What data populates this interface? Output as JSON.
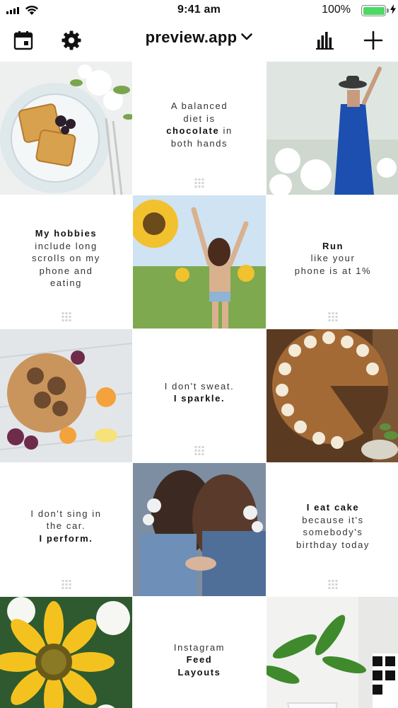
{
  "status_bar": {
    "time": "9:41 am",
    "battery_percent": "100%",
    "battery_level": 1.0,
    "battery_color": "#4cd964"
  },
  "nav": {
    "title": "preview.app",
    "left_icons": [
      "calendar-icon",
      "gear-icon"
    ],
    "right_icons": [
      "bar-chart-icon",
      "plus-icon"
    ]
  },
  "grid": {
    "tiles": [
      {
        "type": "photo",
        "subject": "waffles with berries and flowers on a plate"
      },
      {
        "type": "text",
        "lines": [
          {
            "parts": [
              {
                "text": "A balanced",
                "bold": false
              }
            ]
          },
          {
            "parts": [
              {
                "text": "diet is",
                "bold": false
              }
            ]
          },
          {
            "parts": [
              {
                "text": "chocolate",
                "bold": true
              },
              {
                "text": " in",
                "bold": false
              }
            ]
          },
          {
            "parts": [
              {
                "text": "both hands",
                "bold": false
              }
            ]
          }
        ]
      },
      {
        "type": "photo",
        "subject": "woman in hat and blue dress in a flower field"
      },
      {
        "type": "text",
        "lines": [
          {
            "parts": [
              {
                "text": "My hobbies",
                "bold": true
              }
            ]
          },
          {
            "parts": [
              {
                "text": "include long",
                "bold": false
              }
            ]
          },
          {
            "parts": [
              {
                "text": "scrolls on my",
                "bold": false
              }
            ]
          },
          {
            "parts": [
              {
                "text": "phone and",
                "bold": false
              }
            ]
          },
          {
            "parts": [
              {
                "text": "eating",
                "bold": false
              }
            ]
          }
        ]
      },
      {
        "type": "photo",
        "subject": "woman with raised arms in a sunflower field"
      },
      {
        "type": "text",
        "lines": [
          {
            "parts": [
              {
                "text": "Run",
                "bold": true
              }
            ]
          },
          {
            "parts": [
              {
                "text": "like your",
                "bold": false
              }
            ]
          },
          {
            "parts": [
              {
                "text": "phone is at 1%",
                "bold": false
              }
            ]
          }
        ]
      },
      {
        "type": "photo",
        "subject": "energy balls, passion fruit and oranges on white wood"
      },
      {
        "type": "text",
        "lines": [
          {
            "parts": [
              {
                "text": "I don't sweat.",
                "bold": false
              }
            ]
          },
          {
            "parts": [
              {
                "text": "I sparkle.",
                "bold": true
              }
            ]
          }
        ]
      },
      {
        "type": "photo",
        "subject": "banana nut cake with a slice missing"
      },
      {
        "type": "text",
        "lines": [
          {
            "parts": [
              {
                "text": "I don't sing in",
                "bold": false
              }
            ]
          },
          {
            "parts": [
              {
                "text": "the car.",
                "bold": false
              }
            ]
          },
          {
            "parts": [
              {
                "text": "I perform.",
                "bold": true
              }
            ]
          }
        ]
      },
      {
        "type": "photo",
        "subject": "two friends in denim jackets hugging"
      },
      {
        "type": "text",
        "lines": [
          {
            "parts": [
              {
                "text": "I eat cake",
                "bold": true
              }
            ]
          },
          {
            "parts": [
              {
                "text": "because it's",
                "bold": false
              }
            ]
          },
          {
            "parts": [
              {
                "text": "somebody's",
                "bold": false
              }
            ]
          },
          {
            "parts": [
              {
                "text": "birthday today",
                "bold": false
              }
            ]
          }
        ]
      },
      {
        "type": "photo",
        "subject": "close-up of a sunflower"
      },
      {
        "type": "text",
        "lines": [
          {
            "parts": [
              {
                "text": "Instagram",
                "bold": false
              }
            ]
          },
          {
            "parts": [
              {
                "text": "Feed",
                "bold": true
              }
            ]
          },
          {
            "parts": [
              {
                "text": "Layouts",
                "bold": true
              }
            ]
          }
        ]
      },
      {
        "type": "photo",
        "subject": "potted fern beside a lettered box"
      }
    ]
  }
}
